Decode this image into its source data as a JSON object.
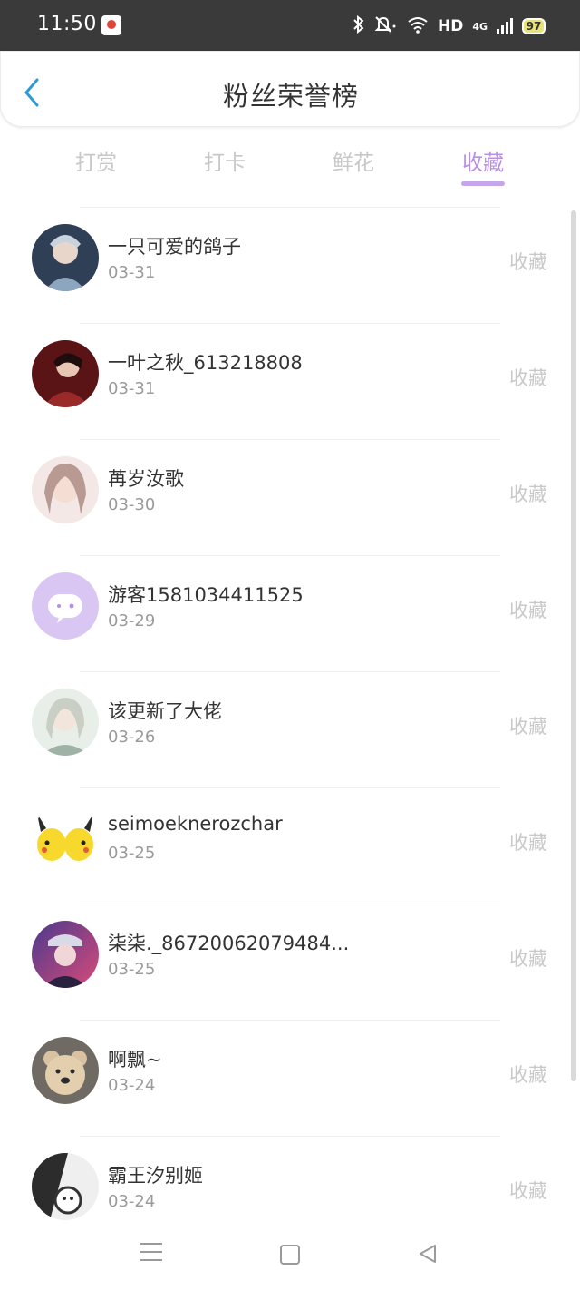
{
  "status_bar": {
    "time": "11:50",
    "hd": "HD",
    "network": "4G",
    "battery": "97",
    "icons": [
      "bluetooth-icon",
      "mute-icon",
      "wifi-icon",
      "signal-icon",
      "battery-icon"
    ]
  },
  "header": {
    "title": "粉丝荣誉榜",
    "back_icon": "chevron-left-icon"
  },
  "tabs": [
    {
      "label": "打赏",
      "active": false
    },
    {
      "label": "打卡",
      "active": false
    },
    {
      "label": "鲜花",
      "active": false
    },
    {
      "label": "收藏",
      "active": true
    }
  ],
  "list": [
    {
      "name": "一只可爱的鸽子",
      "date": "03-31",
      "tag": "收藏"
    },
    {
      "name": "一叶之秋_613218808",
      "date": "03-31",
      "tag": "收藏"
    },
    {
      "name": "苒岁汝歌",
      "date": "03-30",
      "tag": "收藏"
    },
    {
      "name": "游客1581034411525",
      "date": "03-29",
      "tag": "收藏"
    },
    {
      "name": "该更新了大佬",
      "date": "03-26",
      "tag": "收藏"
    },
    {
      "name": "seimoeknerozchar",
      "date": "03-25",
      "tag": "收藏"
    },
    {
      "name": "柒柒._86720062079484...",
      "date": "03-25",
      "tag": "收藏"
    },
    {
      "name": "啊飘~",
      "date": "03-24",
      "tag": "收藏"
    },
    {
      "name": "霸王汐别姬",
      "date": "03-24",
      "tag": "收藏"
    }
  ],
  "colors": {
    "accent": "#b890e0",
    "status_bar": "#3a3a3a",
    "muted": "#c9c9c9"
  },
  "navbar": {
    "icons": [
      "menu-icon",
      "home-icon",
      "back-icon"
    ]
  }
}
